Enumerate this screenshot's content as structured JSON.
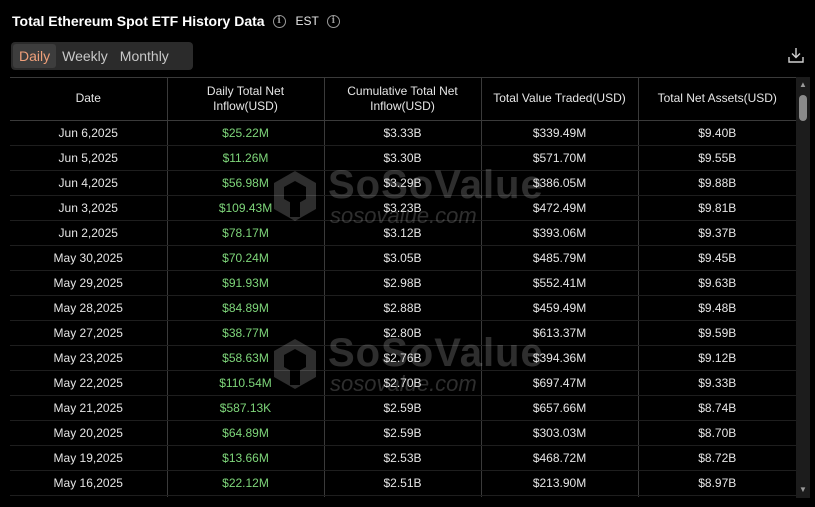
{
  "header": {
    "title": "Total Ethereum Spot ETF History Data",
    "timezone": "EST"
  },
  "tabs": [
    {
      "label": "Daily",
      "active": true
    },
    {
      "label": "Weekly",
      "active": false
    },
    {
      "label": "Monthly",
      "active": false
    }
  ],
  "table": {
    "columns": [
      "Date",
      "Daily Total Net Inflow(USD)",
      "Cumulative Total Net Inflow(USD)",
      "Total Value Traded(USD)",
      "Total Net Assets(USD)"
    ],
    "rows": [
      [
        "Jun 6,2025",
        "$25.22M",
        "$3.33B",
        "$339.49M",
        "$9.40B"
      ],
      [
        "Jun 5,2025",
        "$11.26M",
        "$3.30B",
        "$571.70M",
        "$9.55B"
      ],
      [
        "Jun 4,2025",
        "$56.98M",
        "$3.29B",
        "$386.05M",
        "$9.88B"
      ],
      [
        "Jun 3,2025",
        "$109.43M",
        "$3.23B",
        "$472.49M",
        "$9.81B"
      ],
      [
        "Jun 2,2025",
        "$78.17M",
        "$3.12B",
        "$393.06M",
        "$9.37B"
      ],
      [
        "May 30,2025",
        "$70.24M",
        "$3.05B",
        "$485.79M",
        "$9.45B"
      ],
      [
        "May 29,2025",
        "$91.93M",
        "$2.98B",
        "$552.41M",
        "$9.63B"
      ],
      [
        "May 28,2025",
        "$84.89M",
        "$2.88B",
        "$459.49M",
        "$9.48B"
      ],
      [
        "May 27,2025",
        "$38.77M",
        "$2.80B",
        "$613.37M",
        "$9.59B"
      ],
      [
        "May 23,2025",
        "$58.63M",
        "$2.76B",
        "$394.36M",
        "$9.12B"
      ],
      [
        "May 22,2025",
        "$110.54M",
        "$2.70B",
        "$697.47M",
        "$9.33B"
      ],
      [
        "May 21,2025",
        "$587.13K",
        "$2.59B",
        "$657.66M",
        "$8.74B"
      ],
      [
        "May 20,2025",
        "$64.89M",
        "$2.59B",
        "$303.03M",
        "$8.70B"
      ],
      [
        "May 19,2025",
        "$13.66M",
        "$2.53B",
        "$468.72M",
        "$8.72B"
      ],
      [
        "May 16,2025",
        "$22.12M",
        "$2.51B",
        "$213.90M",
        "$8.97B"
      ],
      [
        "",
        "",
        "",
        "",
        ""
      ]
    ]
  },
  "watermark": {
    "brand": "SoSoValue",
    "domain": "sosovalue.com"
  },
  "colors": {
    "positive": "#7ed67a",
    "active_tab": "#f0a07a",
    "background": "#000000"
  },
  "icons": {
    "info": "info-icon",
    "download": "download-icon"
  }
}
